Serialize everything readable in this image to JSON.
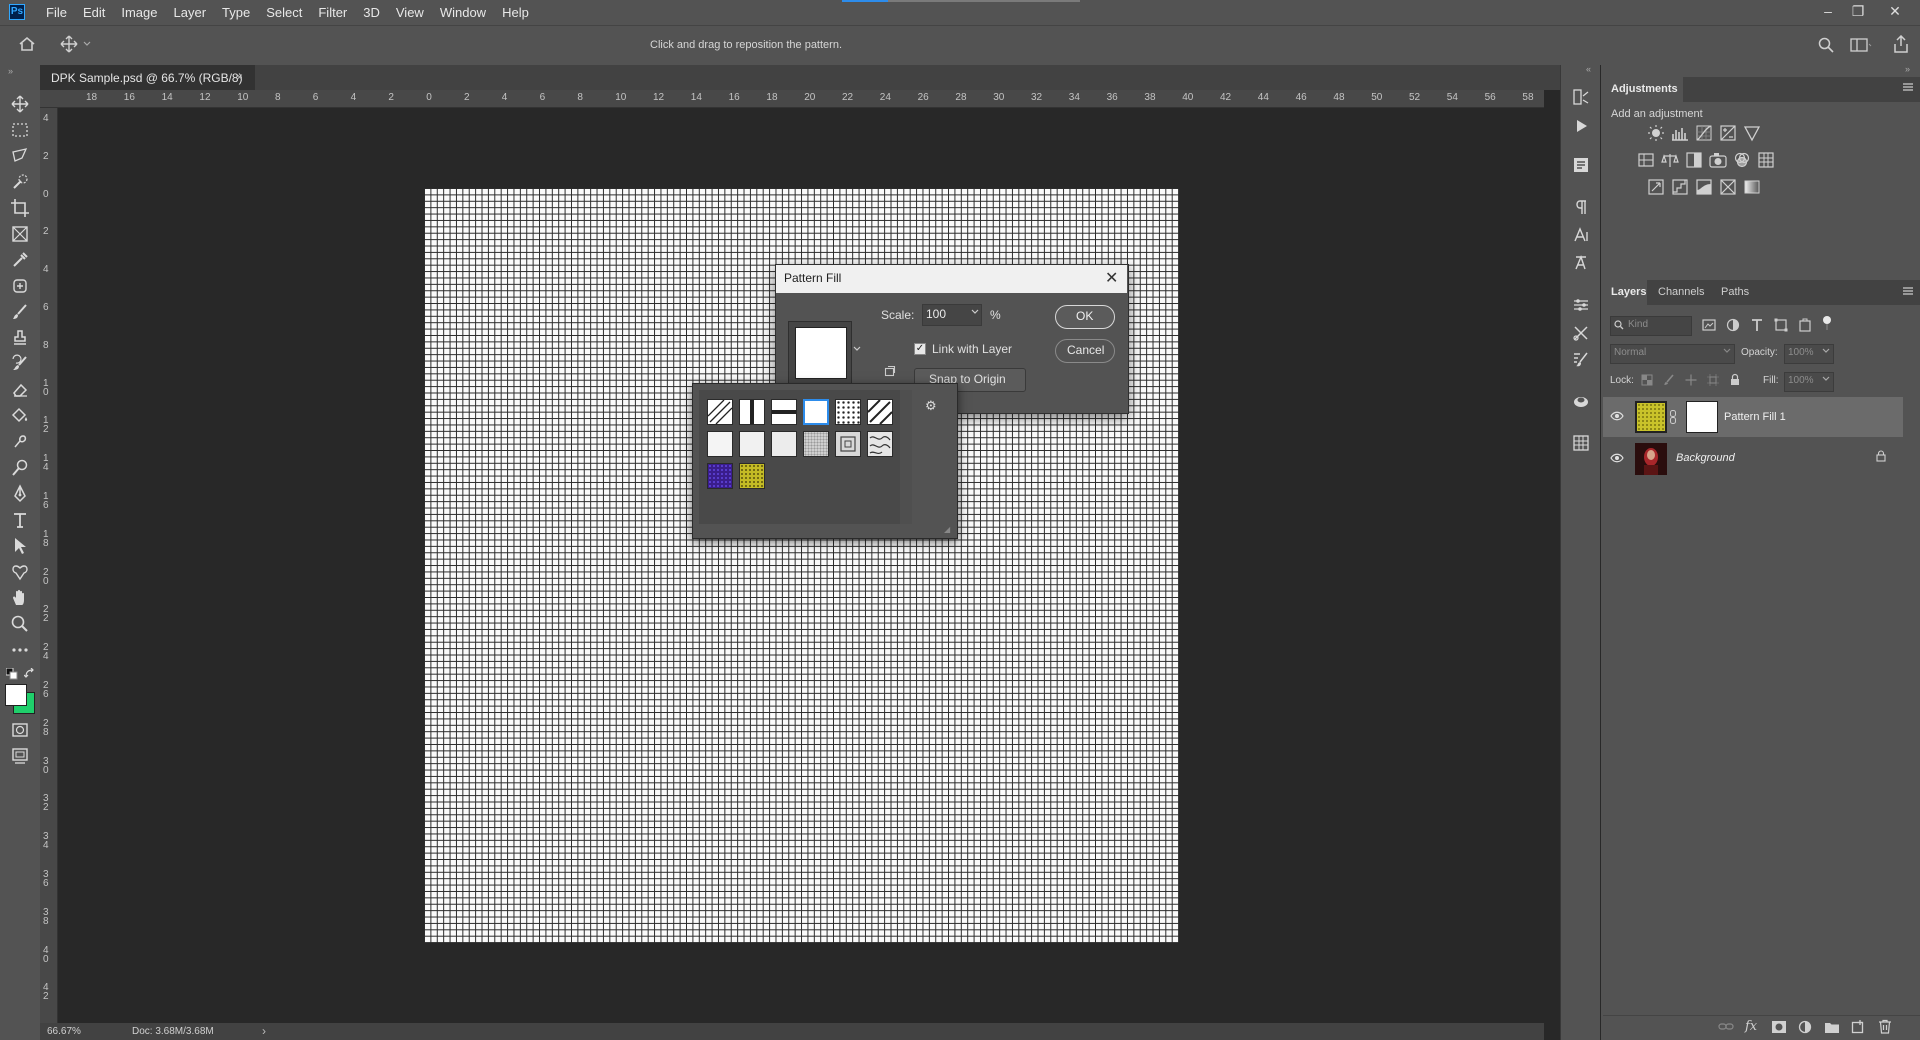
{
  "app": {
    "logo_text": "Ps"
  },
  "menu": [
    "File",
    "Edit",
    "Image",
    "Layer",
    "Type",
    "Select",
    "Filter",
    "3D",
    "View",
    "Window",
    "Help"
  ],
  "window_controls": {
    "minimize": "–",
    "restore": "❐",
    "close": "✕"
  },
  "options_bar": {
    "hint": "Click and drag to reposition the pattern."
  },
  "document": {
    "tab_title": "DPK Sample.psd @ 66.7% (RGB/8)",
    "tab_close": "×",
    "ruler_top_labels": [
      "18",
      "16",
      "14",
      "12",
      "10",
      "8",
      "6",
      "4",
      "2",
      "0",
      "2",
      "4",
      "6",
      "8",
      "10",
      "12",
      "14",
      "16",
      "18",
      "20",
      "22",
      "24",
      "26",
      "28",
      "30",
      "32",
      "34",
      "36",
      "38",
      "40",
      "42",
      "44",
      "46",
      "48",
      "50",
      "52",
      "54",
      "56",
      "58"
    ],
    "ruler_left_labels": [
      "4",
      "2",
      "0",
      "2",
      "4",
      "6",
      "8",
      "10",
      "12",
      "14",
      "16",
      "18",
      "20",
      "22",
      "24",
      "26",
      "28",
      "30",
      "32",
      "34",
      "36",
      "38",
      "40",
      "42"
    ]
  },
  "status": {
    "zoom": "66.67%",
    "doc": "Doc: 3.68M/3.68M",
    "arrow": "›"
  },
  "adjustments": {
    "tab": "Adjustments",
    "subtitle": "Add an adjustment"
  },
  "layers_panel": {
    "tabs": [
      "Layers",
      "Channels",
      "Paths"
    ],
    "kind_placeholder": "Kind",
    "blend_mode": "Normal",
    "opacity_label": "Opacity:",
    "opacity_value": "100%",
    "lock_label": "Lock:",
    "fill_label": "Fill:",
    "fill_value": "100%",
    "layers": [
      {
        "name": "Pattern Fill 1"
      },
      {
        "name": "Background"
      }
    ]
  },
  "dialog": {
    "title": "Pattern Fill",
    "close": "✕",
    "scale_label": "Scale:",
    "scale_value": "100",
    "scale_unit": "%",
    "link_label": "Link with Layer",
    "link_checked": "✓",
    "snap_label": "Snap to Origin",
    "ok_label": "OK",
    "cancel_label": "Cancel"
  },
  "colors": {
    "accent": "#2d8ceb",
    "foreground_swatch": "#ffffff",
    "background_swatch": "#1fcf6b"
  }
}
